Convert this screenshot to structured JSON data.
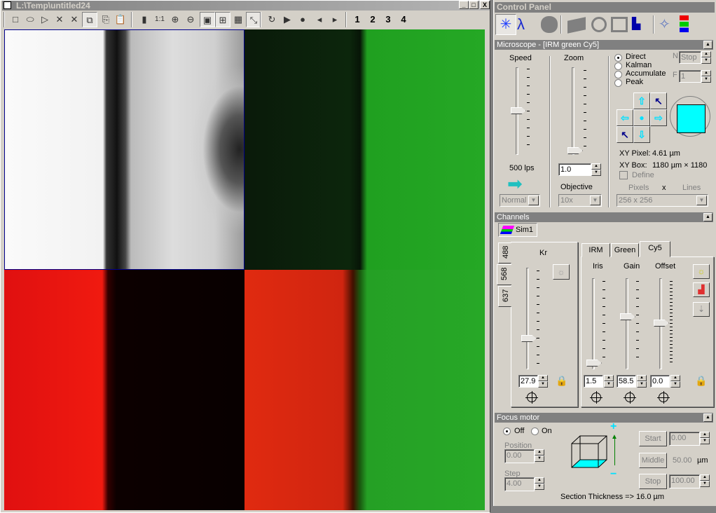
{
  "image_window": {
    "title": "L:\\Temp\\untitled24",
    "controls": [
      "_",
      "□",
      "X"
    ],
    "toolbar": [
      {
        "icon": "rectangle-icon",
        "glyph": "□"
      },
      {
        "icon": "ellipse-icon",
        "glyph": "⬭"
      },
      {
        "icon": "polygon-icon",
        "glyph": "▷"
      },
      {
        "icon": "delete-icon",
        "glyph": "✕"
      },
      {
        "icon": "delete-all-icon",
        "glyph": "✕"
      },
      {
        "icon": "select-shapes-icon",
        "glyph": "⧉"
      },
      {
        "icon": "copy-icon",
        "glyph": "⎘"
      },
      {
        "icon": "paste-icon",
        "glyph": "📋"
      },
      {
        "icon": "single-view-icon",
        "glyph": "▮"
      },
      {
        "icon": "actual-size-icon",
        "glyph": "1:1"
      },
      {
        "icon": "zoom-in-icon",
        "glyph": "⊕"
      },
      {
        "icon": "zoom-out-icon",
        "glyph": "⊖"
      },
      {
        "icon": "fit-icon",
        "glyph": "▣"
      },
      {
        "icon": "quad-view-icon",
        "glyph": "⊞"
      },
      {
        "icon": "tile-icon",
        "glyph": "▦"
      },
      {
        "icon": "overlay-icon",
        "glyph": "⤡"
      },
      {
        "icon": "loop-icon",
        "glyph": "↻"
      },
      {
        "icon": "play-icon",
        "glyph": "▶"
      },
      {
        "icon": "record-icon",
        "glyph": "●"
      },
      {
        "icon": "previous-icon",
        "glyph": "◂"
      },
      {
        "icon": "next-icon",
        "glyph": "▸"
      }
    ],
    "channel_buttons": [
      "1",
      "2",
      "3",
      "4"
    ]
  },
  "control_panel": {
    "title": "Control Panel",
    "microscope": {
      "header": "Microscope - [IRM green Cy5]",
      "speed_label": "Speed",
      "speed_value": "500 lps",
      "speed_mode": "Normal",
      "zoom_label": "Zoom",
      "zoom_value": "1.0",
      "objective_label": "Objective",
      "objective_value": "10x",
      "modes": [
        "Direct",
        "Kalman",
        "Accumulate",
        "Peak"
      ],
      "selected_mode": "Direct",
      "n_label": "N",
      "n_value": "Stop",
      "f_label": "F",
      "f_value": "1",
      "xy_pixel_label": "XY Pixel:",
      "xy_pixel_value": "4.61 µm",
      "xy_box_label": "XY Box:",
      "xy_box_value": "1180 µm × 1180",
      "define_label": "Define",
      "pixels_label": "Pixels",
      "x_label": "x",
      "lines_label": "Lines",
      "resolution": "256 x 256",
      "scan_area_color": "#00ffff"
    },
    "channels": {
      "header": "Channels",
      "sim_label": "Sim1",
      "laser_tabs": [
        "488",
        "568",
        "637"
      ],
      "selected_laser": "568",
      "kr_label": "Kr",
      "kr_value": "27.9",
      "detector_tabs": [
        "IRM",
        "Green",
        "Cy5"
      ],
      "selected_detector": "Cy5",
      "iris_label": "Iris",
      "iris_value": "1.5",
      "gain_label": "Gain",
      "gain_value": "58.5",
      "offset_label": "Offset",
      "offset_value": "0.0"
    },
    "focus": {
      "header": "Focus motor",
      "off_label": "Off",
      "on_label": "On",
      "selected": "Off",
      "position_label": "Position",
      "position_value": "0.00",
      "step_label": "Step",
      "step_value": "4.00",
      "plus": "+",
      "minus": "−",
      "start_label": "Start",
      "start_value": "0.00",
      "middle_label": "Middle",
      "middle_value": "50.00",
      "unit": "µm",
      "stop_label": "Stop",
      "stop_value": "100.00",
      "section_thickness": "Section Thickness => 16.0 µm"
    }
  }
}
